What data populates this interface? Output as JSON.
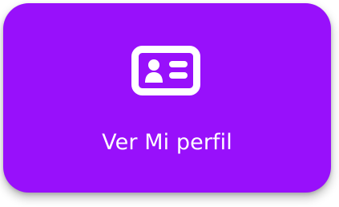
{
  "card": {
    "label": "Ver Mi perfil",
    "icon": "id-card-icon",
    "background_color": "#9810fb",
    "text_color": "#ffffff"
  }
}
